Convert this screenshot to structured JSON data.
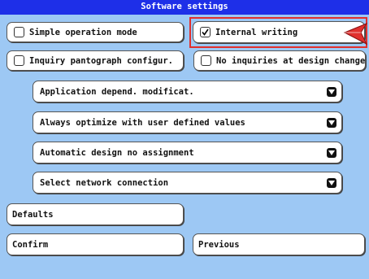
{
  "window": {
    "title": "Software settings"
  },
  "checkboxes": [
    {
      "label": "Simple operation mode",
      "checked": false
    },
    {
      "label": "Internal writing",
      "checked": true
    },
    {
      "label": "Inquiry pantograph configur.",
      "checked": false
    },
    {
      "label": "No inquiries at design change",
      "checked": false
    }
  ],
  "dropdowns": [
    {
      "label": "Application depend. modificat."
    },
    {
      "label": "Always optimize with user defined values"
    },
    {
      "label": "Automatic design no assignment"
    },
    {
      "label": "Select network connection"
    }
  ],
  "buttons": {
    "defaults": "Defaults",
    "confirm": "Confirm",
    "previous": "Previous"
  },
  "colors": {
    "background": "#9dc8f4",
    "titlebar": "#1e2fe8",
    "highlight": "#e0302e"
  }
}
